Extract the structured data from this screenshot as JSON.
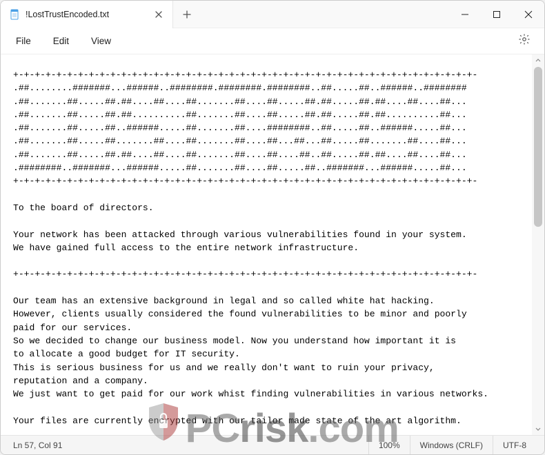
{
  "window": {
    "tab_title": "!LostTrustEncoded.txt"
  },
  "menubar": {
    "file": "File",
    "edit": "Edit",
    "view": "View"
  },
  "body_text": "+-+-+-+-+-+-+-+-+-+-+-+-+-+-+-+-+-+-+-+-+-+-+-+-+-+-+-+-+-+-+-+-+-+-+-+-+-+-+-+-+-+-+-\n.##........#######...######..########.########.########..##.....##..######..########\n.##.......##.....##.##....##....##.......##....##.....##.##.....##.##....##....##...\n.##.......##.....##.##..........##.......##....##.....##.##.....##.##..........##...\n.##.......##.....##..######.....##.......##....########..##.....##..######.....##...\n.##.......##.....##.......##....##.......##....##...##...##.....##.......##....##...\n.##.......##.....##.##....##....##.......##....##....##..##.....##.##....##....##...\n.########..#######...######.....##.......##....##.....##..#######...######.....##...\n+-+-+-+-+-+-+-+-+-+-+-+-+-+-+-+-+-+-+-+-+-+-+-+-+-+-+-+-+-+-+-+-+-+-+-+-+-+-+-+-+-+-+-\n\nTo the board of directors.\n\nYour network has been attacked through various vulnerabilities found in your system.\nWe have gained full access to the entire network infrastructure.\n\n+-+-+-+-+-+-+-+-+-+-+-+-+-+-+-+-+-+-+-+-+-+-+-+-+-+-+-+-+-+-+-+-+-+-+-+-+-+-+-+-+-+-+-\n\nOur team has an extensive background in legal and so called white hat hacking.\nHowever, clients usually considered the found vulnerabilities to be minor and poorly\npaid for our services.\nSo we decided to change our business model. Now you understand how important it is\nto allocate a good budget for IT security.\nThis is serious business for us and we really don't want to ruin your privacy,\nreputation and a company.\nWe just want to get paid for our work whist finding vulnerabilities in various networks.\n\nYour files are currently encrypted with our tailor made state of the art algorithm.",
  "status": {
    "position": "Ln 57, Col 91",
    "zoom": "100%",
    "eol": "Windows (CRLF)",
    "encoding": "UTF-8"
  },
  "watermark": {
    "text_left": "PC",
    "text_mid": "risk",
    "text_right": ".com"
  }
}
